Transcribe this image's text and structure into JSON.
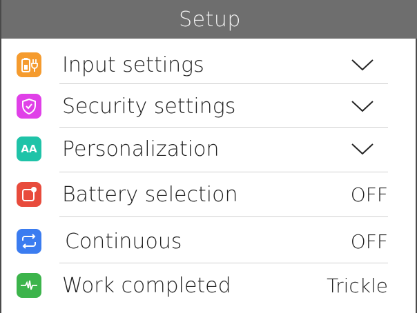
{
  "header": {
    "title": "Setup"
  },
  "colors": {
    "header_bg": "#6e6e6e",
    "input_icon": "#f59b2e",
    "security_icon": "#e040e8",
    "personalization_icon": "#1fc3a8",
    "battery_icon": "#e84b3c",
    "continuous_icon": "#3b7cf0",
    "work_icon": "#3cb44b"
  },
  "rows": [
    {
      "label": "Input settings",
      "icon": "battery-plug-icon",
      "control": "chevron-down"
    },
    {
      "label": "Security settings",
      "icon": "shield-check-icon",
      "control": "chevron-down"
    },
    {
      "label": "Personalization",
      "icon": "text-size-icon",
      "icon_text": "AA",
      "control": "chevron-down"
    },
    {
      "label": "Battery selection",
      "icon": "battery-selection-icon",
      "value": "OFF"
    },
    {
      "label": "Continuous",
      "icon": "repeat-icon",
      "value": "OFF"
    },
    {
      "label": "Work completed",
      "icon": "pulse-icon",
      "value": "Trickle"
    }
  ]
}
